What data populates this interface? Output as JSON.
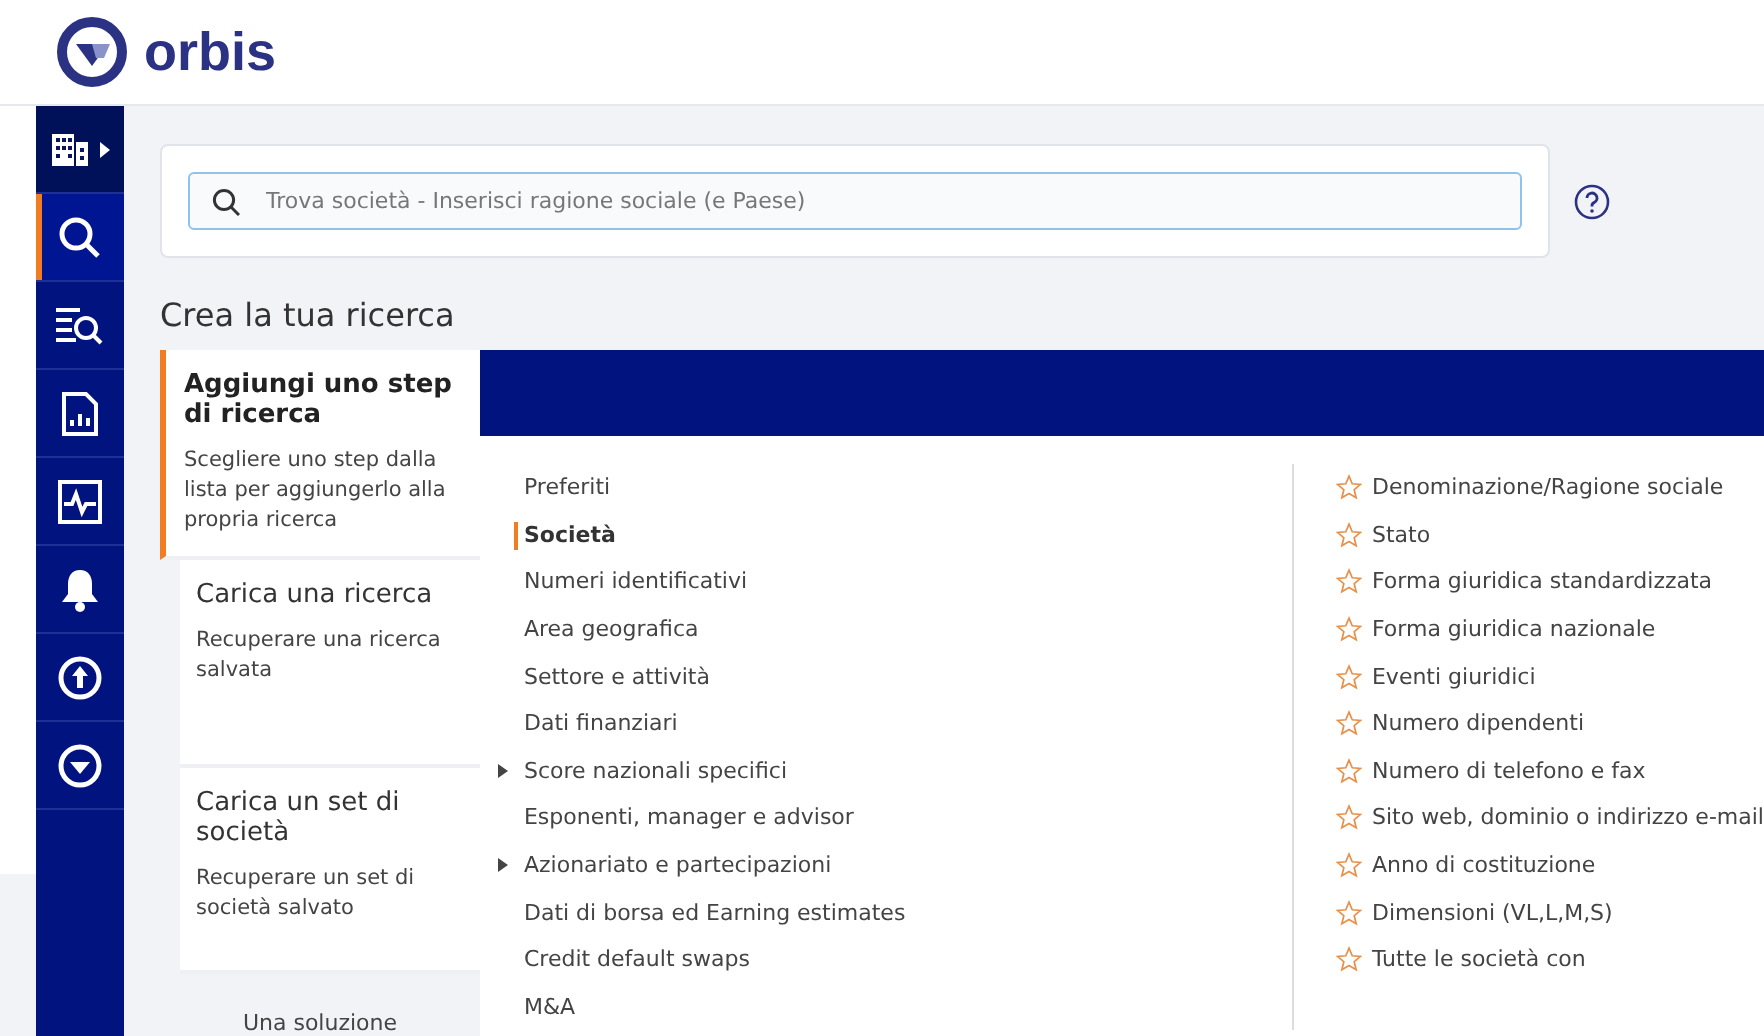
{
  "header": {
    "logo_text": "orbis"
  },
  "sidebar": {
    "items": [
      {
        "kind": "companies",
        "selected": false,
        "expandable": true
      },
      {
        "kind": "search",
        "selected": true,
        "expandable": false
      },
      {
        "kind": "list-search",
        "selected": false,
        "expandable": false
      },
      {
        "kind": "report",
        "selected": false,
        "expandable": false
      },
      {
        "kind": "pulse",
        "selected": false,
        "expandable": false
      },
      {
        "kind": "alerts",
        "selected": false,
        "expandable": false
      },
      {
        "kind": "upload",
        "selected": false,
        "expandable": false
      },
      {
        "kind": "logo",
        "selected": false,
        "expandable": false
      }
    ]
  },
  "search": {
    "placeholder": "Trova società - Inserisci ragione sociale (e Paese)"
  },
  "heading": "Crea la tua ricerca",
  "steps": [
    {
      "title": "Aggiungi uno step di ricerca",
      "description": "Scegliere uno step dalla lista per aggiungerlo alla propria ricerca",
      "selected": true
    },
    {
      "title": "Carica una ricerca",
      "description": "Recuperare una ricerca salvata",
      "selected": false
    },
    {
      "title": "Carica un set di società",
      "description": "Recuperare un set di società salvato",
      "selected": false
    }
  ],
  "footer_text": "Una soluzione",
  "categories": [
    {
      "label": "Preferiti",
      "selected": false,
      "expandable": false
    },
    {
      "label": "Società",
      "selected": true,
      "expandable": false
    },
    {
      "label": "Numeri identificativi",
      "selected": false,
      "expandable": false
    },
    {
      "label": "Area geografica",
      "selected": false,
      "expandable": false
    },
    {
      "label": "Settore e attività",
      "selected": false,
      "expandable": false
    },
    {
      "label": "Dati finanziari",
      "selected": false,
      "expandable": false
    },
    {
      "label": "Score nazionali specifici",
      "selected": false,
      "expandable": true
    },
    {
      "label": "Esponenti, manager e advisor",
      "selected": false,
      "expandable": false
    },
    {
      "label": "Azionariato e partecipazioni",
      "selected": false,
      "expandable": true
    },
    {
      "label": "Dati di borsa ed Earning estimates",
      "selected": false,
      "expandable": false
    },
    {
      "label": "Credit default swaps",
      "selected": false,
      "expandable": false
    },
    {
      "label": "M&A",
      "selected": false,
      "expandable": false
    }
  ],
  "fields": [
    {
      "label": "Denominazione/Ragione sociale",
      "favorite": false
    },
    {
      "label": "Stato",
      "favorite": false
    },
    {
      "label": "Forma giuridica standardizzata",
      "favorite": false
    },
    {
      "label": "Forma giuridica nazionale",
      "favorite": false
    },
    {
      "label": "Eventi giuridici",
      "favorite": false
    },
    {
      "label": "Numero dipendenti",
      "favorite": false
    },
    {
      "label": "Numero di telefono e fax",
      "favorite": false
    },
    {
      "label": "Sito web, dominio o indirizzo e-mail",
      "favorite": false
    },
    {
      "label": "Anno di costituzione",
      "favorite": false
    },
    {
      "label": "Dimensioni (VL,L,M,S)",
      "favorite": false
    },
    {
      "label": "Tutte le società con",
      "favorite": false
    }
  ]
}
